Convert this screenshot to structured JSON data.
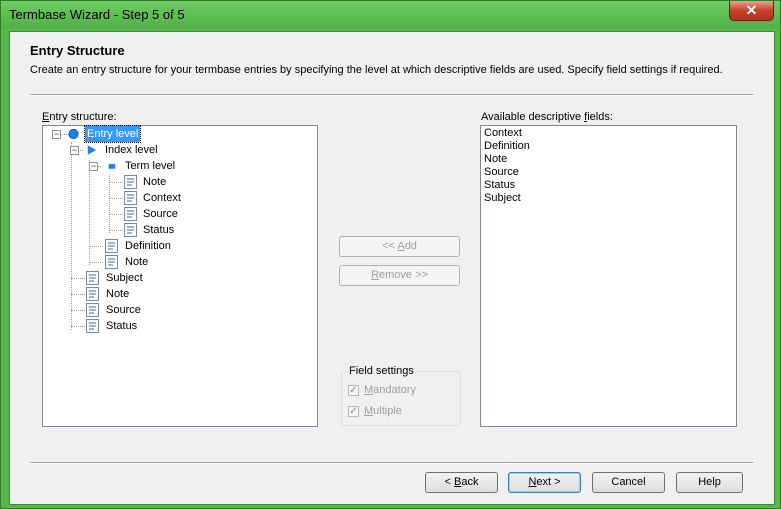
{
  "window": {
    "title": "Termbase Wizard - Step 5 of 5",
    "close_glyph": "✕"
  },
  "header": {
    "title": "Entry Structure",
    "description": "Create an entry structure for your termbase entries by specifying the level at which descriptive fields are used. Specify field settings if required."
  },
  "entry_structure": {
    "label_first": "E",
    "label_rest": "ntry structure:",
    "nodes": [
      {
        "label": "Entry level",
        "icon": "circle-icon",
        "selected": true
      },
      {
        "label": "Index level",
        "icon": "triangle-icon"
      },
      {
        "label": "Term level",
        "icon": "square-icon"
      },
      {
        "label": "Note",
        "icon": "field-icon"
      },
      {
        "label": "Context",
        "icon": "field-icon"
      },
      {
        "label": "Source",
        "icon": "field-icon"
      },
      {
        "label": "Status",
        "icon": "field-icon"
      },
      {
        "label": "Definition",
        "icon": "field-icon"
      },
      {
        "label": "Note",
        "icon": "field-icon"
      },
      {
        "label": "Subject",
        "icon": "field-icon"
      },
      {
        "label": "Note",
        "icon": "field-icon"
      },
      {
        "label": "Source",
        "icon": "field-icon"
      },
      {
        "label": "Status",
        "icon": "field-icon"
      }
    ]
  },
  "middle": {
    "add_pre": "<< ",
    "add_u": "A",
    "add_post": "dd",
    "remove_u": "R",
    "remove_post": "emove >>",
    "field_settings": "Field settings",
    "mandatory_u": "M",
    "mandatory_post": "andatory",
    "multiple_u": "M",
    "multiple_post": "ultiple",
    "check_glyph": "✓"
  },
  "available": {
    "label_pre": "Available descriptive ",
    "label_u": "f",
    "label_post": "ields:",
    "items": [
      "Context",
      "Definition",
      "Note",
      "Source",
      "Status",
      "Subject"
    ]
  },
  "footer": {
    "back_pre": "< ",
    "back_u": "B",
    "back_post": "ack",
    "next_u": "N",
    "next_post": "ext >",
    "cancel": "Cancel",
    "help": "Help"
  }
}
